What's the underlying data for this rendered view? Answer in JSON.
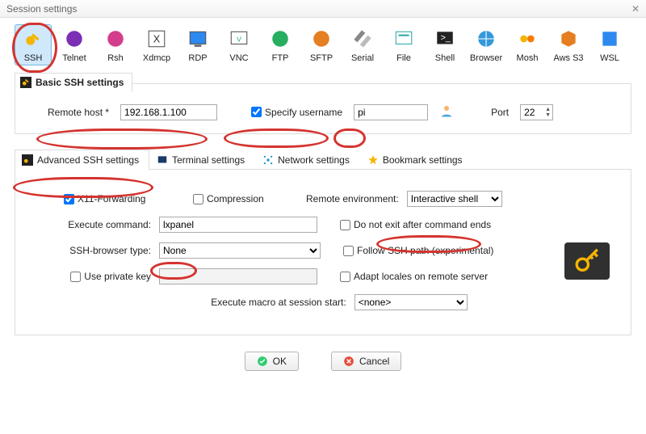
{
  "window": {
    "title": "Session settings"
  },
  "toolbar": {
    "items": [
      "SSH",
      "Telnet",
      "Rsh",
      "Xdmcp",
      "RDP",
      "VNC",
      "FTP",
      "SFTP",
      "Serial",
      "File",
      "Shell",
      "Browser",
      "Mosh",
      "Aws S3",
      "WSL"
    ],
    "selected": "SSH"
  },
  "basic": {
    "group_label": "Basic SSH settings",
    "remote_host_label": "Remote host *",
    "remote_host_value": "192.168.1.100",
    "specify_username_label": "Specify username",
    "specify_username_checked": true,
    "username_value": "pi",
    "port_label": "Port",
    "port_value": "22"
  },
  "subtabs": {
    "items": [
      "Advanced SSH settings",
      "Terminal settings",
      "Network settings",
      "Bookmark settings"
    ],
    "active": "Advanced SSH settings"
  },
  "advanced": {
    "x11_label": "X11-Forwarding",
    "x11_checked": true,
    "compression_label": "Compression",
    "compression_checked": false,
    "remote_env_label": "Remote environment:",
    "remote_env_value": "Interactive shell",
    "exec_cmd_label": "Execute command:",
    "exec_cmd_value": "lxpanel",
    "noexit_label": "Do not exit after command ends",
    "noexit_checked": false,
    "browser_type_label": "SSH-browser type:",
    "browser_type_value": "None",
    "follow_label": "Follow SSH path (experimental)",
    "follow_checked": false,
    "privkey_label": "Use private key",
    "privkey_checked": false,
    "privkey_value": "",
    "adapt_label": "Adapt locales on remote server",
    "adapt_checked": false,
    "macro_label": "Execute macro at session start:",
    "macro_value": "<none>"
  },
  "buttons": {
    "ok": "OK",
    "cancel": "Cancel"
  }
}
